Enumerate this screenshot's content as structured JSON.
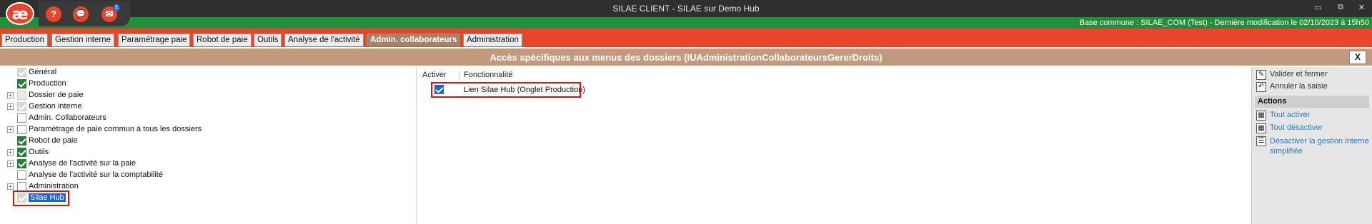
{
  "window": {
    "title": "SILAE CLIENT - SILAE sur Demo Hub",
    "logo_text": "æ",
    "controls": [
      "▭",
      "⧉",
      "✕"
    ]
  },
  "toolbar": {
    "help_icon": "?",
    "chat_icon": "💬",
    "mail_icon": "✉",
    "mail_badge": "1"
  },
  "status": {
    "info": "Base commune : SILAE_COM (Test) - Dernière modification le 02/10/2023 à 15h50"
  },
  "tabs": [
    {
      "label": "Production",
      "active": false
    },
    {
      "label": "Gestion interne",
      "active": false
    },
    {
      "label": "Paramétrage paie",
      "active": false
    },
    {
      "label": "Robot de paie",
      "active": false
    },
    {
      "label": "Outils",
      "active": false
    },
    {
      "label": "Analyse de l'activité",
      "active": false
    },
    {
      "label": "Admin. collaborateurs",
      "active": true
    },
    {
      "label": "Administration",
      "active": false
    }
  ],
  "header": {
    "title": "Accès spécifiques aux menus des dossiers (IUAdministrationCollaborateursGererDroits)",
    "close_label": "X"
  },
  "tree": [
    {
      "label": "Général",
      "checked": true,
      "disabled": true,
      "expandable": false
    },
    {
      "label": "Production",
      "checked": true,
      "disabled": false,
      "expandable": false
    },
    {
      "label": "Dossier de paie",
      "checked": false,
      "disabled": true,
      "expandable": true
    },
    {
      "label": "Gestion interne",
      "checked": true,
      "disabled": true,
      "expandable": true
    },
    {
      "label": "Admin. Collaborateurs",
      "checked": false,
      "disabled": false,
      "expandable": false
    },
    {
      "label": "Paramétrage de paie commun à tous les dossiers",
      "checked": false,
      "disabled": false,
      "expandable": true
    },
    {
      "label": "Robot de paie",
      "checked": true,
      "disabled": false,
      "expandable": false
    },
    {
      "label": "Outils",
      "checked": true,
      "disabled": false,
      "expandable": true
    },
    {
      "label": "Analyse de l'activité sur la paie",
      "checked": true,
      "disabled": false,
      "expandable": true
    },
    {
      "label": "Analyse de l'activité sur la comptabilité",
      "checked": false,
      "disabled": false,
      "expandable": false
    },
    {
      "label": "Administration",
      "checked": false,
      "disabled": false,
      "expandable": true
    },
    {
      "label": "Silae Hub",
      "checked": true,
      "disabled": true,
      "expandable": false,
      "selected": true
    }
  ],
  "grid": {
    "col_activer": "Activer",
    "col_fonctionnalite": "Fonctionnalité",
    "rows": [
      {
        "checked": true,
        "label": "Lien Silae Hub (Onglet Production)"
      }
    ]
  },
  "actions": {
    "validate": "Valider et fermer",
    "cancel": "Annuler la saisie",
    "section_title": "Actions",
    "activate_all": "Tout activer",
    "deactivate_all": "Tout désactiver",
    "disable_simplified": "Désactiver la gestion interne simplifiée"
  }
}
